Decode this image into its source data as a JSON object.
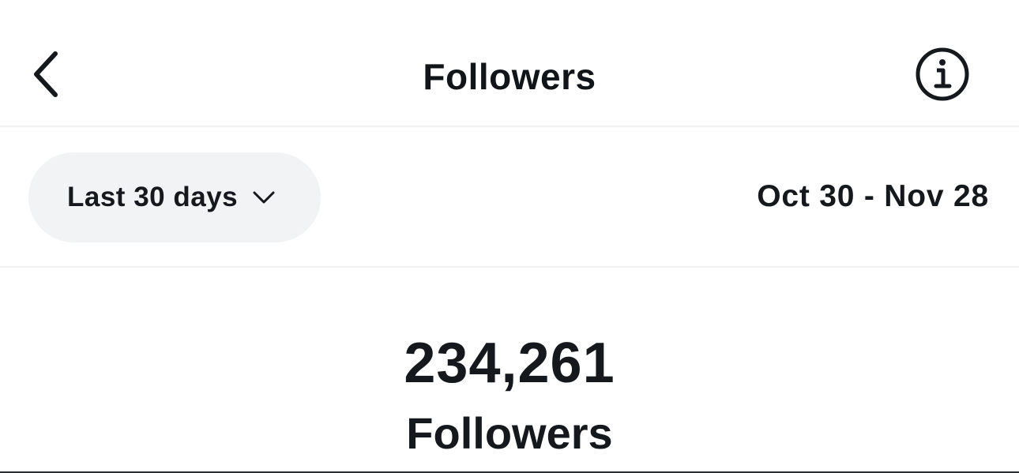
{
  "header": {
    "title": "Followers",
    "back_icon": "chevron-left-icon",
    "info_icon": "info-circle-icon"
  },
  "filters": {
    "range_selected": "Last 30 days",
    "range_icon": "chevron-down-icon",
    "date_range": "Oct 30 - Nov 28"
  },
  "summary": {
    "count": "234,261",
    "label": "Followers"
  },
  "colors": {
    "text": "#15181c",
    "pill_background": "#f1f3f5",
    "divider": "#eef0f2"
  }
}
